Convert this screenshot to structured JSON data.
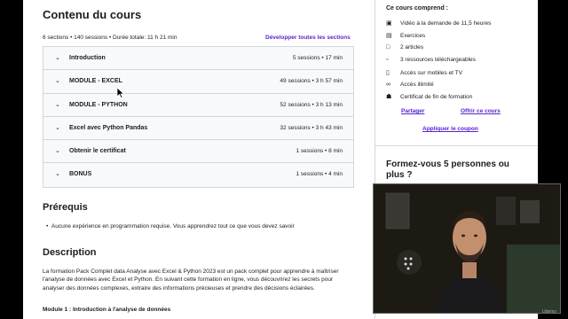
{
  "course_content": {
    "title": "Contenu du cours",
    "meta": "6 sections • 140 sessions • Durée totale: 11 h 21 min",
    "expand_label": "Développer toutes les sections",
    "sections": [
      {
        "title": "Introduction",
        "meta": "5 sessions • 17 min"
      },
      {
        "title": "MODULE - EXCEL",
        "meta": "49 sessions • 3 h 57 min"
      },
      {
        "title": "MODULE - PYTHON",
        "meta": "52 sessions • 3 h 13 min"
      },
      {
        "title": "Excel avec Python Pandas",
        "meta": "32 sessions • 3 h 43 min"
      },
      {
        "title": "Obtenir le certificat",
        "meta": "1 sessions • 8 min"
      },
      {
        "title": "BONUS",
        "meta": "1 sessions • 4 min"
      }
    ]
  },
  "prerequisites": {
    "title": "Prérequis",
    "items": [
      "Aucune expérience en programmation requise. Vous apprendrez tout ce que vous devez savoir"
    ]
  },
  "description": {
    "title": "Description",
    "text": "La formation Pack Complet data Analyse avec Excel & Python 2023 est un pack complet pour apprendre à maîtriser l'analyse de données avec Excel et Python. En suivant cette formation en ligne, vous découvrirez les secrets pour analyser des données complexes, extraire des informations précieuses et prendre des décisions éclairées.",
    "module1": "Module 1 : Introduction à l'analyse de données"
  },
  "sidebar": {
    "includes_title": "Ce cours comprend :",
    "includes": [
      {
        "icon": "video-icon",
        "text": "Vidéo à la demande de 11,5 heures"
      },
      {
        "icon": "exercise-icon",
        "text": "Exercices"
      },
      {
        "icon": "article-icon",
        "text": "2 articles"
      },
      {
        "icon": "download-icon",
        "text": "3 ressources téléchargeables"
      },
      {
        "icon": "mobile-icon",
        "text": "Accès sur mobiles et TV"
      },
      {
        "icon": "infinity-icon",
        "text": "Accès illimité"
      },
      {
        "icon": "trophy-icon",
        "text": "Certificat de fin de formation"
      }
    ],
    "share_label": "Partager",
    "gift_label": "Offrir ce cours",
    "coupon_label": "Appliquer le coupon",
    "train_title": "Formez-vous 5 personnes ou plus ?"
  },
  "watermark": "Udemy",
  "colors": {
    "accent": "#5624d0",
    "section_bg": "#f7f9fa",
    "border": "#d1d7dc"
  }
}
